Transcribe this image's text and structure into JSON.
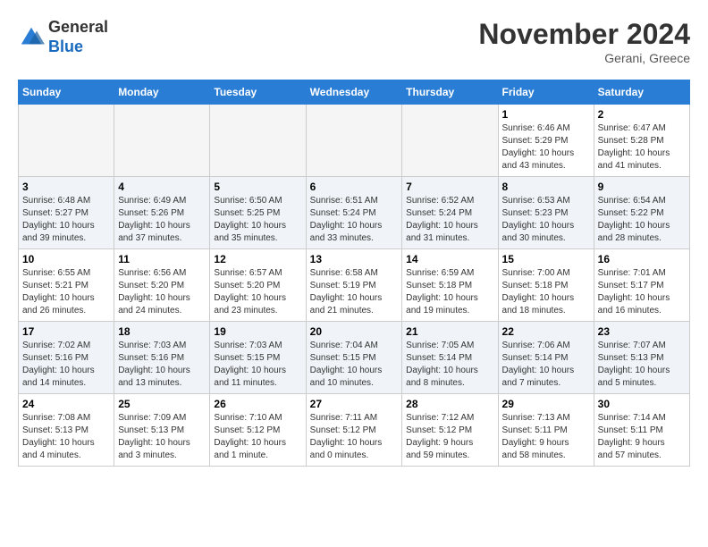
{
  "header": {
    "logo_line1": "General",
    "logo_line2": "Blue",
    "month_title": "November 2024",
    "location": "Gerani, Greece"
  },
  "weekdays": [
    "Sunday",
    "Monday",
    "Tuesday",
    "Wednesday",
    "Thursday",
    "Friday",
    "Saturday"
  ],
  "weeks": [
    [
      {
        "day": "",
        "info": ""
      },
      {
        "day": "",
        "info": ""
      },
      {
        "day": "",
        "info": ""
      },
      {
        "day": "",
        "info": ""
      },
      {
        "day": "",
        "info": ""
      },
      {
        "day": "1",
        "info": "Sunrise: 6:46 AM\nSunset: 5:29 PM\nDaylight: 10 hours\nand 43 minutes."
      },
      {
        "day": "2",
        "info": "Sunrise: 6:47 AM\nSunset: 5:28 PM\nDaylight: 10 hours\nand 41 minutes."
      }
    ],
    [
      {
        "day": "3",
        "info": "Sunrise: 6:48 AM\nSunset: 5:27 PM\nDaylight: 10 hours\nand 39 minutes."
      },
      {
        "day": "4",
        "info": "Sunrise: 6:49 AM\nSunset: 5:26 PM\nDaylight: 10 hours\nand 37 minutes."
      },
      {
        "day": "5",
        "info": "Sunrise: 6:50 AM\nSunset: 5:25 PM\nDaylight: 10 hours\nand 35 minutes."
      },
      {
        "day": "6",
        "info": "Sunrise: 6:51 AM\nSunset: 5:24 PM\nDaylight: 10 hours\nand 33 minutes."
      },
      {
        "day": "7",
        "info": "Sunrise: 6:52 AM\nSunset: 5:24 PM\nDaylight: 10 hours\nand 31 minutes."
      },
      {
        "day": "8",
        "info": "Sunrise: 6:53 AM\nSunset: 5:23 PM\nDaylight: 10 hours\nand 30 minutes."
      },
      {
        "day": "9",
        "info": "Sunrise: 6:54 AM\nSunset: 5:22 PM\nDaylight: 10 hours\nand 28 minutes."
      }
    ],
    [
      {
        "day": "10",
        "info": "Sunrise: 6:55 AM\nSunset: 5:21 PM\nDaylight: 10 hours\nand 26 minutes."
      },
      {
        "day": "11",
        "info": "Sunrise: 6:56 AM\nSunset: 5:20 PM\nDaylight: 10 hours\nand 24 minutes."
      },
      {
        "day": "12",
        "info": "Sunrise: 6:57 AM\nSunset: 5:20 PM\nDaylight: 10 hours\nand 23 minutes."
      },
      {
        "day": "13",
        "info": "Sunrise: 6:58 AM\nSunset: 5:19 PM\nDaylight: 10 hours\nand 21 minutes."
      },
      {
        "day": "14",
        "info": "Sunrise: 6:59 AM\nSunset: 5:18 PM\nDaylight: 10 hours\nand 19 minutes."
      },
      {
        "day": "15",
        "info": "Sunrise: 7:00 AM\nSunset: 5:18 PM\nDaylight: 10 hours\nand 18 minutes."
      },
      {
        "day": "16",
        "info": "Sunrise: 7:01 AM\nSunset: 5:17 PM\nDaylight: 10 hours\nand 16 minutes."
      }
    ],
    [
      {
        "day": "17",
        "info": "Sunrise: 7:02 AM\nSunset: 5:16 PM\nDaylight: 10 hours\nand 14 minutes."
      },
      {
        "day": "18",
        "info": "Sunrise: 7:03 AM\nSunset: 5:16 PM\nDaylight: 10 hours\nand 13 minutes."
      },
      {
        "day": "19",
        "info": "Sunrise: 7:03 AM\nSunset: 5:15 PM\nDaylight: 10 hours\nand 11 minutes."
      },
      {
        "day": "20",
        "info": "Sunrise: 7:04 AM\nSunset: 5:15 PM\nDaylight: 10 hours\nand 10 minutes."
      },
      {
        "day": "21",
        "info": "Sunrise: 7:05 AM\nSunset: 5:14 PM\nDaylight: 10 hours\nand 8 minutes."
      },
      {
        "day": "22",
        "info": "Sunrise: 7:06 AM\nSunset: 5:14 PM\nDaylight: 10 hours\nand 7 minutes."
      },
      {
        "day": "23",
        "info": "Sunrise: 7:07 AM\nSunset: 5:13 PM\nDaylight: 10 hours\nand 5 minutes."
      }
    ],
    [
      {
        "day": "24",
        "info": "Sunrise: 7:08 AM\nSunset: 5:13 PM\nDaylight: 10 hours\nand 4 minutes."
      },
      {
        "day": "25",
        "info": "Sunrise: 7:09 AM\nSunset: 5:13 PM\nDaylight: 10 hours\nand 3 minutes."
      },
      {
        "day": "26",
        "info": "Sunrise: 7:10 AM\nSunset: 5:12 PM\nDaylight: 10 hours\nand 1 minute."
      },
      {
        "day": "27",
        "info": "Sunrise: 7:11 AM\nSunset: 5:12 PM\nDaylight: 10 hours\nand 0 minutes."
      },
      {
        "day": "28",
        "info": "Sunrise: 7:12 AM\nSunset: 5:12 PM\nDaylight: 9 hours\nand 59 minutes."
      },
      {
        "day": "29",
        "info": "Sunrise: 7:13 AM\nSunset: 5:11 PM\nDaylight: 9 hours\nand 58 minutes."
      },
      {
        "day": "30",
        "info": "Sunrise: 7:14 AM\nSunset: 5:11 PM\nDaylight: 9 hours\nand 57 minutes."
      }
    ]
  ]
}
